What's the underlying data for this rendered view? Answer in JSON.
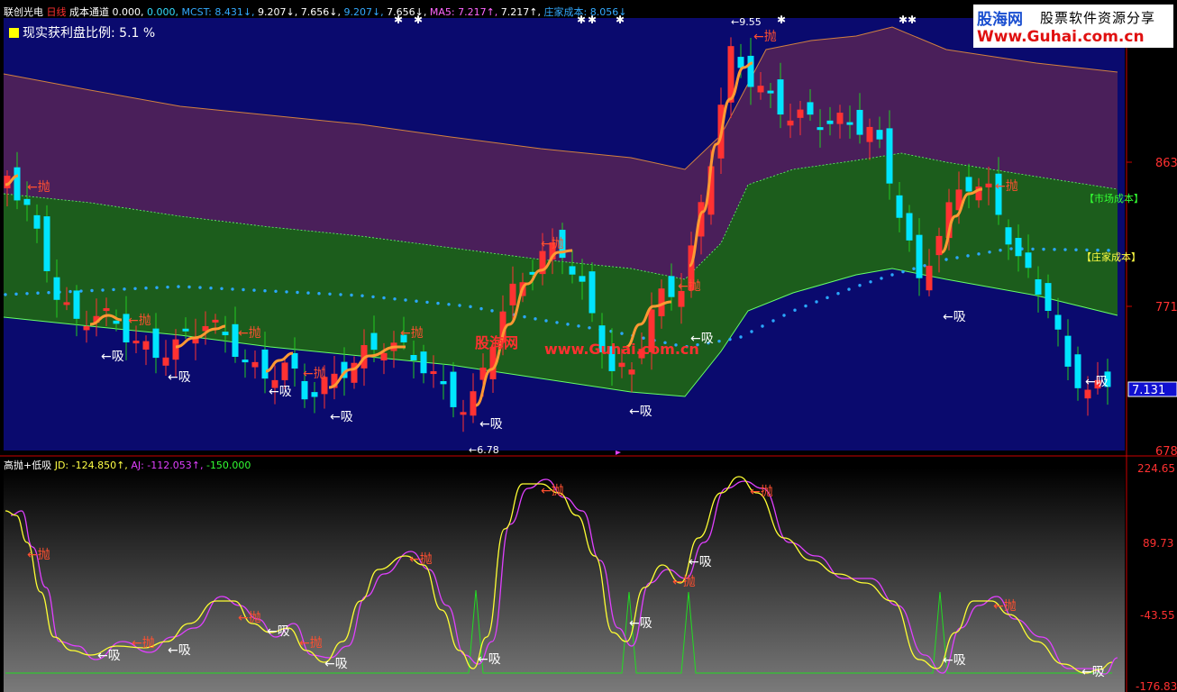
{
  "colors": {
    "up": "#ff3232",
    "down": "#00e5ff",
    "bull_fill": "#1a7a1a",
    "band_upper": "#4a1f5a",
    "band_mid": "#1c5d1c",
    "band_bg": "#0a0a6e",
    "ma_line": "#ff9933",
    "dot": "#2aa8ff",
    "label_sell": "#ff5030",
    "label_buy": "#ffffff",
    "jd": "#ffff33",
    "aj": "#e040ff",
    "zero": "#22dd22",
    "axis": "#cc0000",
    "text_cyan": "#33aaff",
    "text_yellow": "#ffff44"
  },
  "header": {
    "stock_name": "联创光电",
    "period": "日线",
    "indicator": "成本通道",
    "items": [
      {
        "label": "0.000,",
        "color": "#ffffff"
      },
      {
        "label": "0.000,",
        "color": "#33ddff"
      },
      {
        "label": "MCST: 8.431↓,",
        "color": "#33aaff"
      },
      {
        "label": "9.207↓,",
        "color": "#ffffff"
      },
      {
        "label": "7.656↓,",
        "color": "#ffffff"
      },
      {
        "label": "9.207↓,",
        "color": "#33aaff"
      },
      {
        "label": "7.656↓,",
        "color": "#ffffff"
      },
      {
        "label": "MA5: 7.217↑,",
        "color": "#ff66ff"
      },
      {
        "label": "7.217↑,",
        "color": "#ffffff"
      },
      {
        "label": "庄家成本: 8.056↓",
        "color": "#33aaff"
      }
    ]
  },
  "legend": {
    "swatch_color": "#ffff00",
    "text": "现实获利盘比例: 5.1 %"
  },
  "watermark": {
    "logo": "股海网",
    "slogan": "股票软件资源分享",
    "url": "Www.Guhai.com.cn"
  },
  "center_watermark": {
    "cn": "股海网",
    "url": "www.Guhai.com.cn"
  },
  "main_axis": {
    "labels": [
      "863",
      "771",
      "678"
    ],
    "current_price": "7.131"
  },
  "band_labels": {
    "market": "【市场成本】",
    "dealer": "【庄家成本】"
  },
  "price_markers": {
    "high": "9.55",
    "low": "6.78"
  },
  "signals": {
    "sell": "←抛",
    "buy": "←吸"
  },
  "sub_header": {
    "name": "高抛+低吸",
    "jd": "JD: -124.850↑,",
    "aj": "AJ: -112.053↑,",
    "extra": "-150.000"
  },
  "sub_axis": {
    "labels": [
      "224.65",
      "89.73",
      "-43.55",
      "-176.83"
    ]
  },
  "chart_data": [
    {
      "type": "candlestick",
      "title": "成本通道",
      "ylim": [
        6.78,
        9.55
      ],
      "y_ticks": [
        8.63,
        7.71,
        6.78
      ],
      "current_price": 7.131,
      "high": 9.55,
      "low": 6.78,
      "series": [
        {
          "name": "MCST",
          "value": 8.431
        },
        {
          "name": "MA5",
          "value": 7.217
        },
        {
          "name": "庄家成本",
          "value": 8.056
        }
      ],
      "profit_ratio_percent": 5.1
    },
    {
      "type": "line",
      "title": "高抛+低吸",
      "ylim": [
        -176.83,
        224.65
      ],
      "y_ticks": [
        224.65,
        89.73,
        -43.55,
        -176.83
      ],
      "series": [
        {
          "name": "JD",
          "last": -124.85
        },
        {
          "name": "AJ",
          "last": -112.053
        }
      ],
      "baseline": -150.0
    }
  ]
}
